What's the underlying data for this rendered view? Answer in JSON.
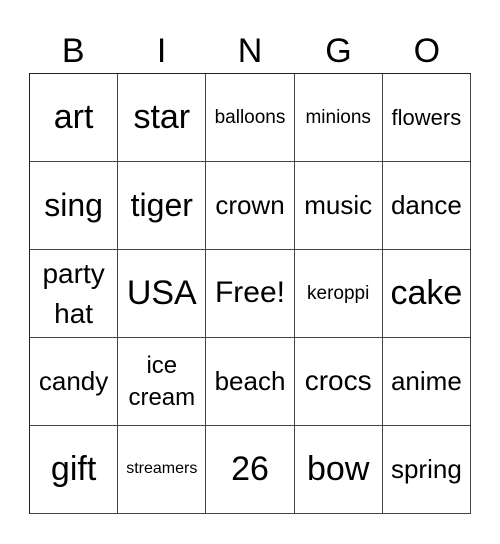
{
  "header": [
    "B",
    "I",
    "N",
    "G",
    "O"
  ],
  "cells": [
    [
      "art",
      "star",
      "balloons",
      "minions",
      "flowers"
    ],
    [
      "sing",
      "tiger",
      "crown",
      "music",
      "dance"
    ],
    [
      "party hat",
      "USA",
      "Free!",
      "keroppi",
      "cake"
    ],
    [
      "candy",
      "ice cream",
      "beach",
      "crocs",
      "anime"
    ],
    [
      "gift",
      "streamers",
      "26",
      "bow",
      "spring"
    ]
  ]
}
